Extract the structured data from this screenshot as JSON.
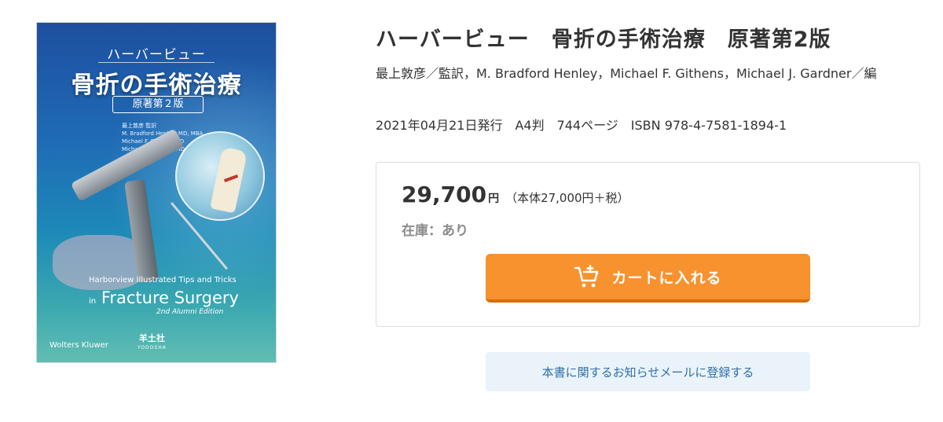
{
  "cover": {
    "subtitle": "ハーバービュー",
    "title": "骨折の手術治療",
    "edition": "原著第２版",
    "editors": [
      "最上敦彦 監訳",
      "M. Bradford Henley, MD, MBA",
      "Michael F. Githens, MD",
      "Michael J. Gardner, MD"
    ],
    "en_line1": "Harborview Illustrated Tips and Tricks",
    "en_in": "in",
    "en_line2": "Fracture Surgery",
    "en_line3": "2nd Alumni Edition",
    "publisher_left": "Wolters Kluwer",
    "publisher_right": "羊土社",
    "publisher_right_en": "YODOSHA"
  },
  "product": {
    "title": "ハーバービュー　骨折の手術治療　原著第2版",
    "editors": "最上敦彦／監訳，M. Bradford Henley，Michael F. Githens，Michael J. Gardner／編",
    "meta": "2021年04月21日発行　A4判　744ページ　ISBN 978-4-7581-1894-1"
  },
  "purchase": {
    "price": "29,700",
    "currency": "円",
    "price_note": "（本体27,000円＋税）",
    "stock": "在庫：あり",
    "cart_label": "カートに入れる",
    "cart_icon": "cart-plus-icon"
  },
  "notify": {
    "label": "本書に関するお知らせメールに登録する"
  },
  "colors": {
    "cart_button": "#f8922e",
    "notify_button_bg": "#eaf3fa",
    "notify_text": "#2f6fa8"
  }
}
